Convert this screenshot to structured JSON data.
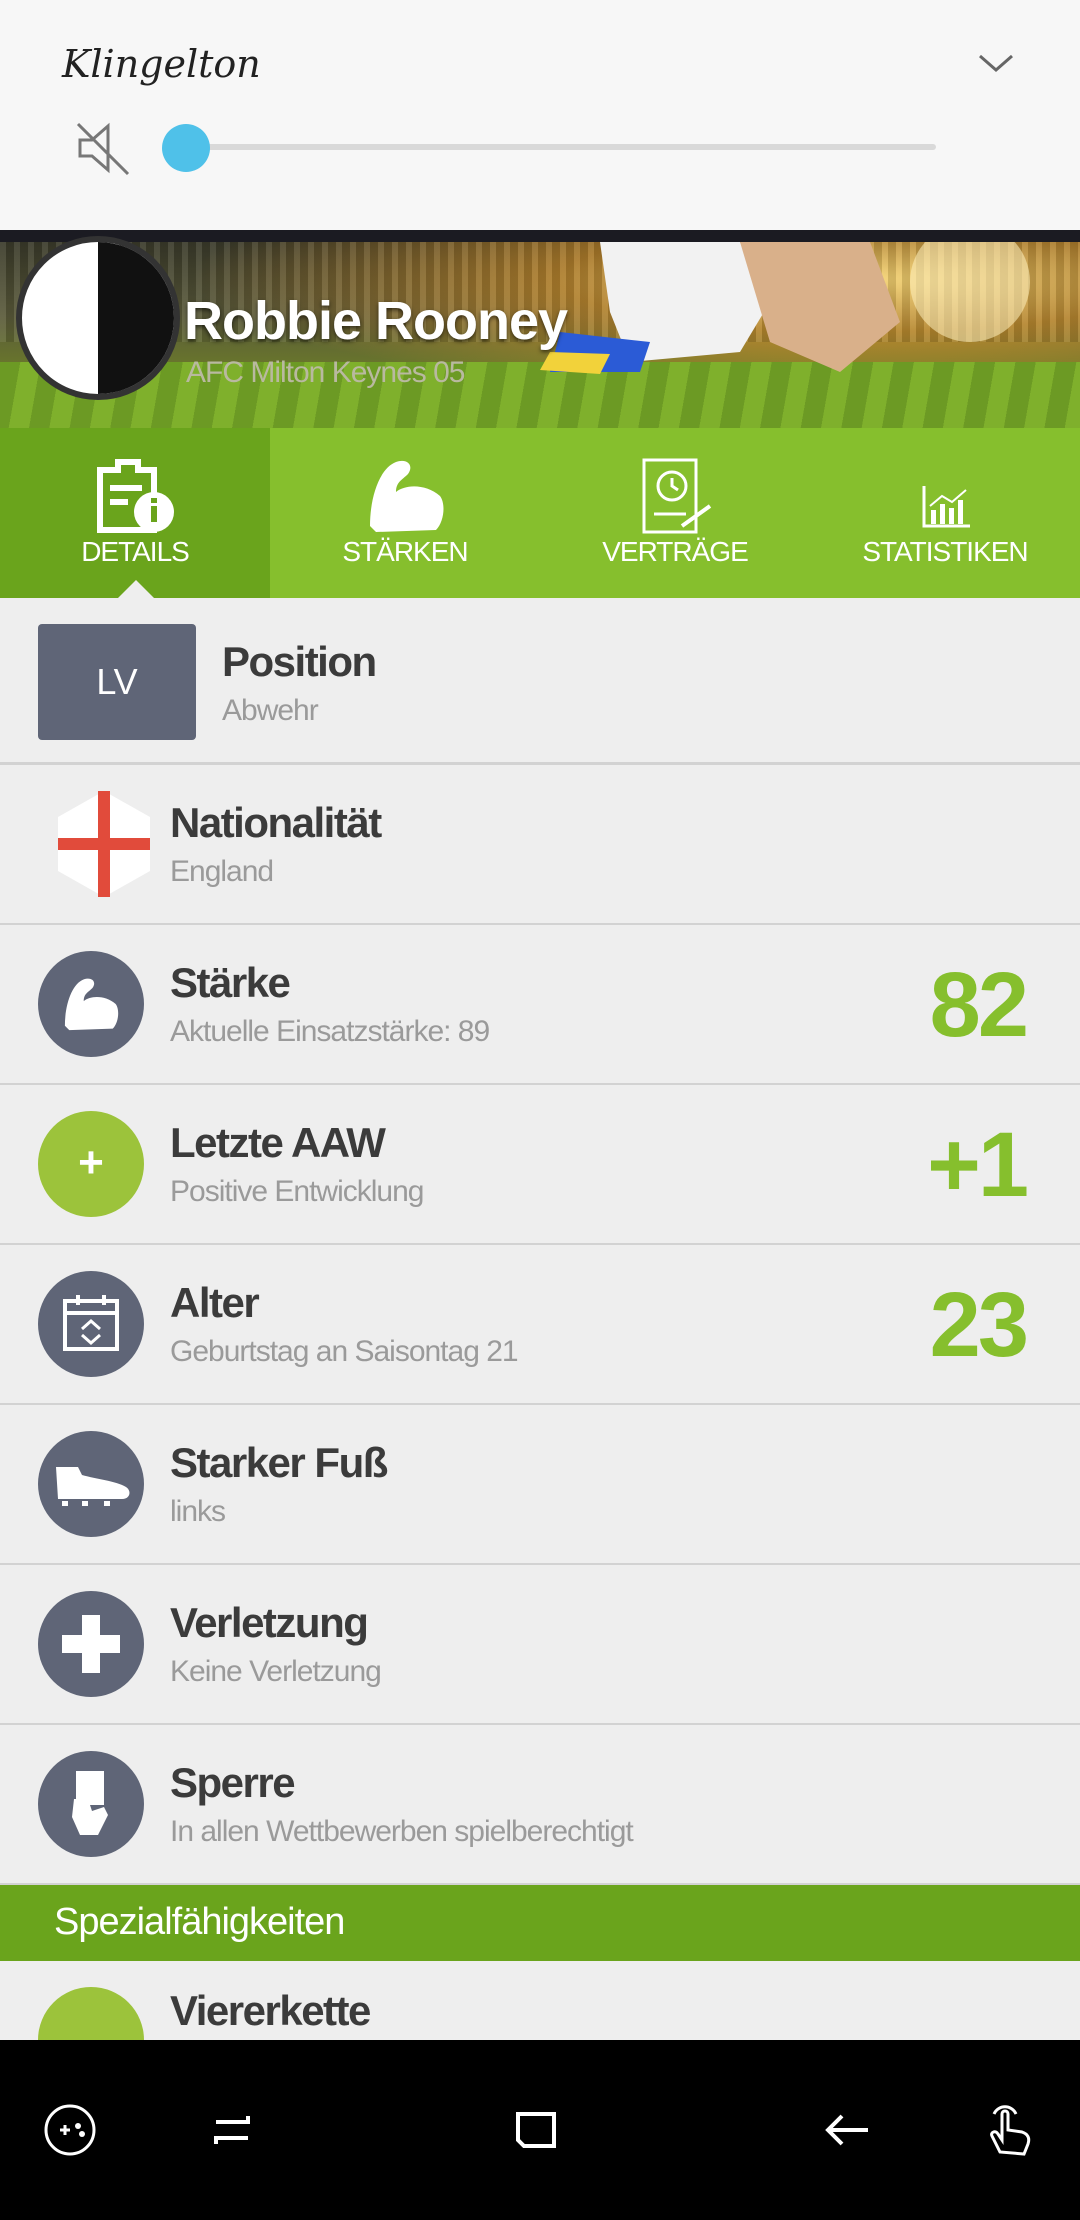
{
  "volume_panel": {
    "title": "Klingelton",
    "level_fraction": 0.0
  },
  "player": {
    "name": "Robbie Rooney",
    "club": "AFC Milton Keynes 05"
  },
  "tabs": [
    {
      "label": "DETAILS",
      "icon": "details-icon",
      "active": true
    },
    {
      "label": "STÄRKEN",
      "icon": "strength-icon",
      "active": false
    },
    {
      "label": "VERTRÄGE",
      "icon": "contract-icon",
      "active": false
    },
    {
      "label": "STATISTIKEN",
      "icon": "statistics-icon",
      "active": false
    }
  ],
  "rows": {
    "position": {
      "badge": "LV",
      "title": "Position",
      "subtitle": "Abwehr"
    },
    "nationality": {
      "title": "Nationalität",
      "subtitle": "England",
      "icon": "england-flag-icon"
    },
    "strength": {
      "title": "Stärke",
      "subtitle": "Aktuelle Einsatzstärke: 89",
      "value": "82",
      "icon": "muscle-icon"
    },
    "last_aaw": {
      "title": "Letzte AAW",
      "subtitle": "Positive Entwicklung",
      "value": "+1",
      "icon_text": "+"
    },
    "age": {
      "title": "Alter",
      "subtitle": "Geburtstag an Saisontag 21",
      "value": "23",
      "icon": "calendar-icon"
    },
    "foot": {
      "title": "Starker Fuß",
      "subtitle": "links",
      "icon": "boot-icon"
    },
    "injury": {
      "title": "Verletzung",
      "subtitle": "Keine Verletzung",
      "icon": "medical-cross-icon"
    },
    "suspension": {
      "title": "Sperre",
      "subtitle": "In allen Wettbewerben spielberechtigt",
      "icon": "card-hand-icon"
    }
  },
  "section": {
    "title": "Spezialfähigkeiten",
    "first_item": {
      "title": "Viererkette"
    }
  },
  "colors": {
    "accent_green": "#86bf2d",
    "dark_green": "#6aa41c",
    "icon_slate": "#5f6577",
    "lime_icon": "#9cc33b"
  },
  "navbar": [
    "game-launcher-icon",
    "recent-apps-icon",
    "home-icon",
    "back-icon",
    "touch-icon"
  ]
}
